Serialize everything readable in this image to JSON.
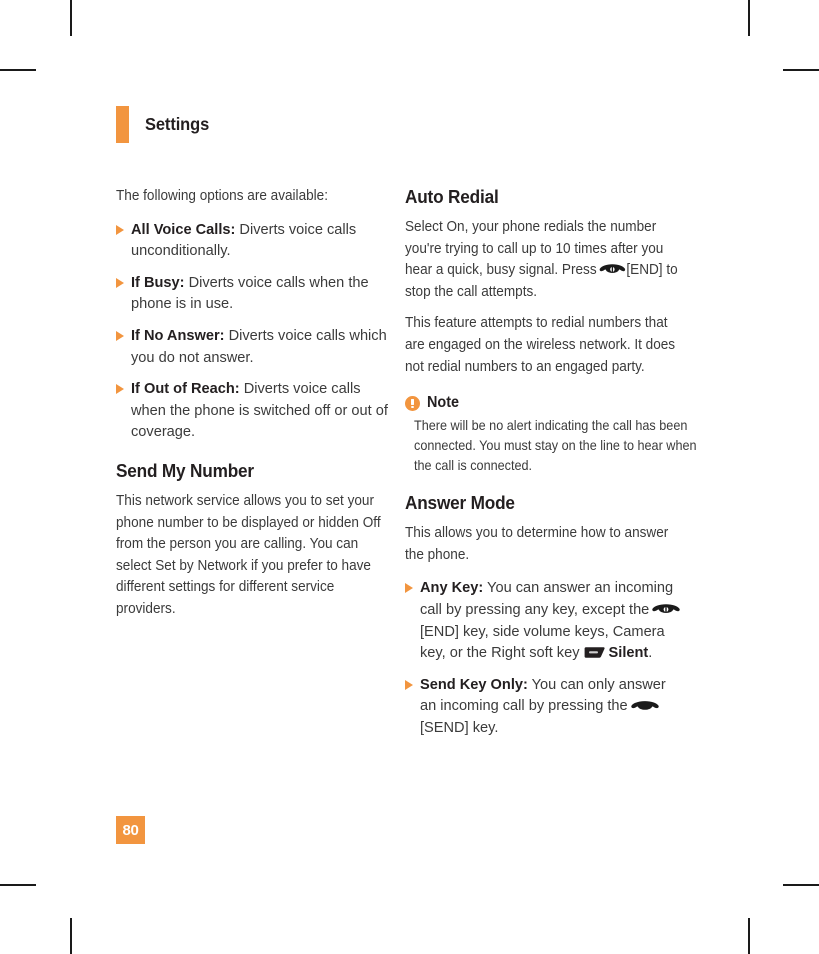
{
  "header": {
    "title": "Settings"
  },
  "page_number": "80",
  "left_column": {
    "intro": "The following options are available:",
    "bullets": [
      {
        "term": "All Voice Calls:",
        "desc": " Diverts voice calls unconditionally."
      },
      {
        "term": "If Busy:",
        "desc": " Diverts voice calls when the phone is in use."
      },
      {
        "term": "If No Answer:",
        "desc": " Diverts voice calls which you do not answer."
      },
      {
        "term": "If Out of Reach:",
        "desc": " Diverts voice calls when the phone is switched off or out of coverage."
      }
    ],
    "section_heading": "Send My Number",
    "section_body": "This network service allows you to set your phone number to be displayed or hidden Off from the person you are calling. You can select Set by Network if you prefer to have different settings for different service providers."
  },
  "right_column": {
    "auto_redial": {
      "heading": "Auto Redial",
      "para1_a": "Select On, your phone redials the number you're trying to call up to 10 times after you hear a quick, busy signal. Press",
      "para1_b": "[END] to stop the call attempts.",
      "para2": "This feature attempts to redial numbers that are engaged on the wireless network. It does not redial numbers to an engaged party."
    },
    "note": {
      "label": "Note",
      "body": "There will be no alert indicating the call has been connected. You must stay on the line to hear when the call is connected."
    },
    "answer_mode": {
      "heading": "Answer Mode",
      "intro": "This allows you to determine how to answer the phone.",
      "bullets": [
        {
          "term": "Any Key:",
          "desc_a": " You can answer an incoming call by pressing any key, except the",
          "desc_b": "[END] key, side volume keys, Camera key, or the Right soft key",
          "desc_c": "Silent",
          "desc_d": "."
        },
        {
          "term": "Send Key Only:",
          "desc_a": " You can only answer an incoming call by pressing the",
          "desc_b": "[SEND] key."
        }
      ]
    }
  },
  "icons": {
    "end_key": "end-call-key-icon",
    "send_key": "send-call-key-icon",
    "soft_key": "right-soft-key-icon",
    "note": "note-alert-icon",
    "bullet": "triangle-bullet-icon"
  },
  "colors": {
    "accent": "#F2953F",
    "text": "#3b3b3b",
    "heading": "#231f20"
  }
}
